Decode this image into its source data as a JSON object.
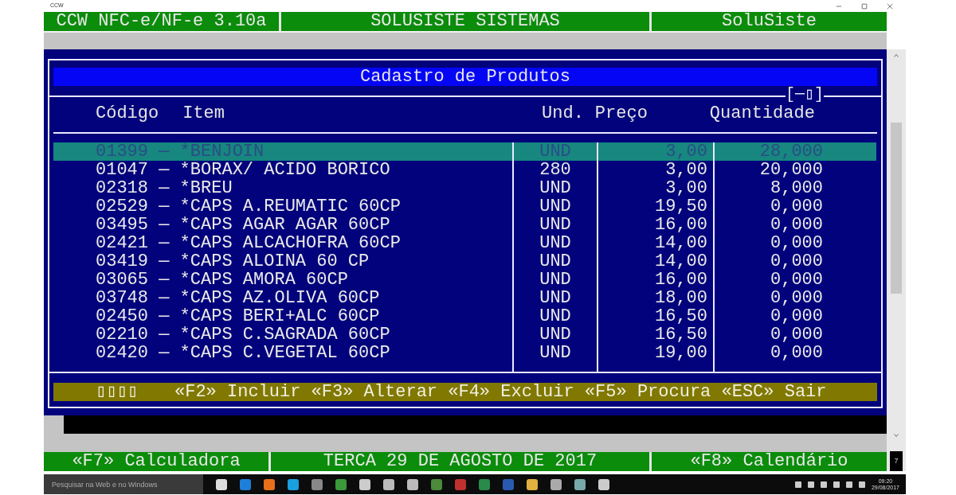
{
  "window": {
    "title": "CCW"
  },
  "top_bar": [
    "CCW NFC-e/NF-e 3.10a",
    "SOLUSISTE SISTEMAS",
    "SoluSiste"
  ],
  "dialog": {
    "title": "Cadastro de Produtos",
    "scroll_marker": "[─▯]",
    "columns": [
      "Código",
      "Item",
      "Und.",
      "Preço",
      "Quantidade"
    ],
    "rows": [
      {
        "code_item": "01399 — *BENJOIN",
        "unit": "UND",
        "price": "3,00",
        "quantity": "28,000",
        "selected": true
      },
      {
        "code_item": "01047 — *BORAX/ ACIDO BORICO",
        "unit": "280",
        "price": "3,00",
        "quantity": "20,000",
        "selected": false
      },
      {
        "code_item": "02318 — *BREU",
        "unit": "UND",
        "price": "3,00",
        "quantity": "8,000",
        "selected": false
      },
      {
        "code_item": "02529 — *CAPS A.REUMATIC 60CP",
        "unit": "UND",
        "price": "19,50",
        "quantity": "0,000",
        "selected": false
      },
      {
        "code_item": "03495 — *CAPS AGAR AGAR 60CP",
        "unit": "UND",
        "price": "16,00",
        "quantity": "0,000",
        "selected": false
      },
      {
        "code_item": "02421 — *CAPS ALCACHOFRA 60CP",
        "unit": "UND",
        "price": "14,00",
        "quantity": "0,000",
        "selected": false
      },
      {
        "code_item": "03419 — *CAPS ALOINA 60 CP",
        "unit": "UND",
        "price": "14,00",
        "quantity": "0,000",
        "selected": false
      },
      {
        "code_item": "03065 — *CAPS AMORA 60CP",
        "unit": "UND",
        "price": "16,00",
        "quantity": "0,000",
        "selected": false
      },
      {
        "code_item": "03748 — *CAPS AZ.OLIVA 60CP",
        "unit": "UND",
        "price": "18,00",
        "quantity": "0,000",
        "selected": false
      },
      {
        "code_item": "02450 — *CAPS BERI+ALC 60CP",
        "unit": "UND",
        "price": "16,50",
        "quantity": "0,000",
        "selected": false
      },
      {
        "code_item": "02210 — *CAPS C.SAGRADA 60CP",
        "unit": "UND",
        "price": "16,50",
        "quantity": "0,000",
        "selected": false
      },
      {
        "code_item": "02420 — *CAPS C.VEGETAL 60CP",
        "unit": "UND",
        "price": "19,00",
        "quantity": "0,000",
        "selected": false
      }
    ],
    "status_glyphs": "▯▯▯▯",
    "commands": "«F2» Incluir «F3» Alterar «F4» Excluir «F5» Procura «ESC» Sair"
  },
  "side_label": "7",
  "bottom_bar": [
    "«F7» Calculadora",
    "TERCA 29 DE AGOSTO DE 2017",
    "«F8» Calendário"
  ],
  "taskbar": {
    "search": {
      "placeholder": "Pesquisar na Web e no Windows"
    },
    "time": "09:20",
    "date": "29/08/2017"
  }
}
